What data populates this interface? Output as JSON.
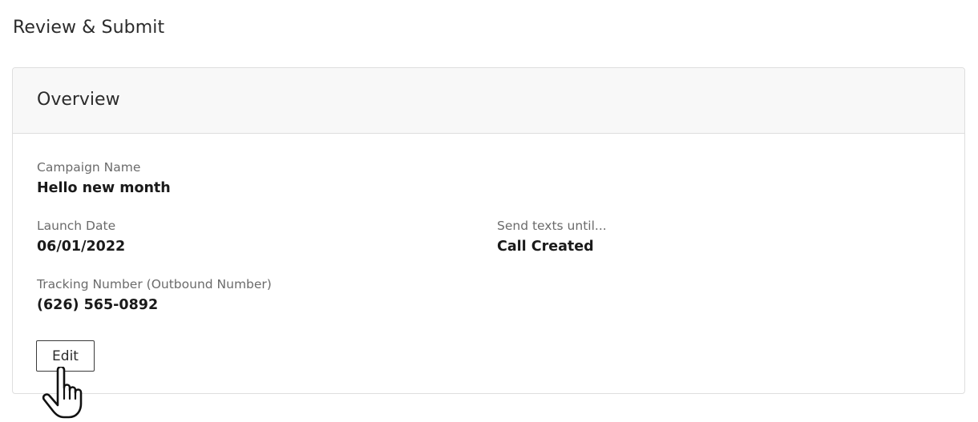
{
  "page": {
    "title": "Review & Submit"
  },
  "overview": {
    "title": "Overview",
    "fields": {
      "campaign_name": {
        "label": "Campaign Name",
        "value": "Hello new month"
      },
      "launch_date": {
        "label": "Launch Date",
        "value": "06/01/2022"
      },
      "send_texts_until": {
        "label": "Send texts until...",
        "value": "Call Created"
      },
      "tracking_number": {
        "label": "Tracking Number (Outbound Number)",
        "value": "(626) 565-0892"
      }
    },
    "edit_label": "Edit"
  },
  "cursor": {
    "icon": "hand-pointer-icon"
  }
}
